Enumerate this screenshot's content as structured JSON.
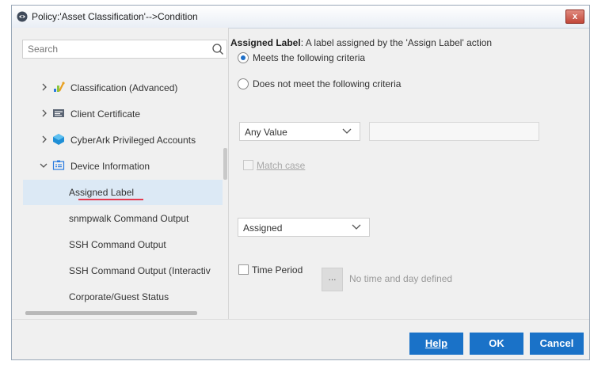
{
  "window": {
    "title": "Policy:'Asset Classification'-->Condition",
    "close_label": "x"
  },
  "search": {
    "placeholder": "Search"
  },
  "tree": {
    "items": [
      {
        "label": "Classification (Advanced)",
        "icon": "classification-icon"
      },
      {
        "label": "Client Certificate",
        "icon": "certificate-icon"
      },
      {
        "label": "CyberArk Privileged Accounts",
        "icon": "cyberark-icon"
      },
      {
        "label": "Device Information",
        "icon": "device-info-icon",
        "expanded": true
      }
    ],
    "children": [
      {
        "label": "Assigned Label",
        "selected": true
      },
      {
        "label": "snmpwalk Command Output"
      },
      {
        "label": "SSH Command Output"
      },
      {
        "label": "SSH Command Output (Interactiv"
      },
      {
        "label": "Corporate/Guest Status"
      }
    ]
  },
  "condition": {
    "title": "Assigned Label",
    "description": ": A label assigned by the 'Assign Label' action",
    "radio_meets": "Meets the following criteria",
    "radio_not_meets": "Does not meet the following criteria",
    "selected_radio": "meets",
    "match_select": "Any Value",
    "match_value": "",
    "match_case": "Match case",
    "assigned_select": "Assigned",
    "time_period": "Time Period",
    "time_button": "...",
    "time_status": "No time and day defined"
  },
  "buttons": {
    "help": "Help",
    "ok": "OK",
    "cancel": "Cancel"
  },
  "colors": {
    "accent": "#1a72c8",
    "selection": "#dce9f5",
    "underline": "#e53a4f"
  }
}
